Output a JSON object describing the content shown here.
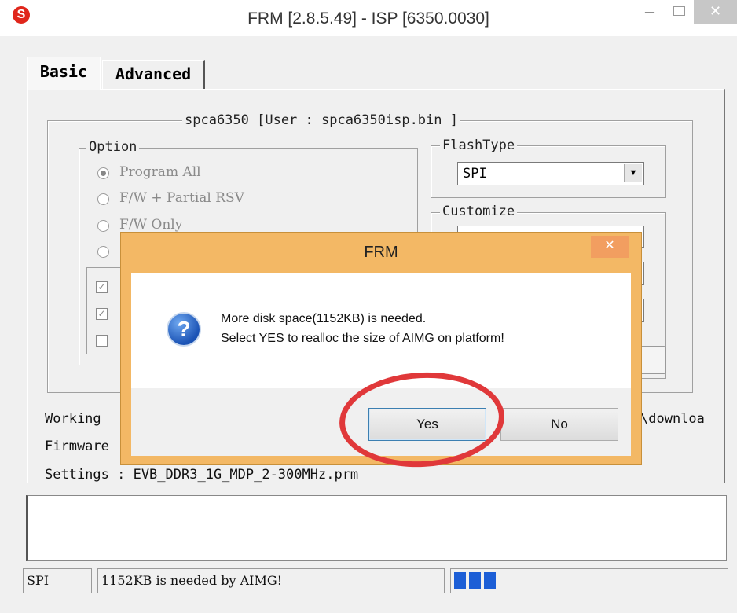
{
  "window": {
    "logo_glyph": "S",
    "title": "FRM [2.8.5.49] - ISP [6350.0030]",
    "minimize_glyph": "–",
    "close_glyph": "✕"
  },
  "tabs": [
    {
      "label": "Basic",
      "active": true
    },
    {
      "label": "Advanced",
      "active": false
    }
  ],
  "main_group": {
    "legend": "spca6350 [User : spca6350isp.bin ]"
  },
  "option_group": {
    "legend": "Option",
    "radios": [
      {
        "label": "Program All",
        "selected": true
      },
      {
        "label": "F/W + Partial RSV",
        "selected": false
      },
      {
        "label": "F/W Only",
        "selected": false
      },
      {
        "label": "",
        "selected": false
      }
    ],
    "checkboxes": [
      {
        "checked": true
      },
      {
        "checked": true
      },
      {
        "checked": false
      }
    ]
  },
  "flashtype": {
    "legend": "FlashType",
    "value": "SPI"
  },
  "customize": {
    "legend": "Customize"
  },
  "info": {
    "working_label": "Working",
    "working_tail": "\\downloa",
    "firmware_label": "Firmware",
    "settings_line": "Settings : EVB_DDR3_1G_MDP_2-300MHz.prm"
  },
  "dialog": {
    "title": "FRM",
    "close_glyph": "✕",
    "icon_glyph": "?",
    "message_line1": "More disk space(1152KB) is needed.",
    "message_line2": "Select YES to realloc the size of AIMG on platform!",
    "yes_label": "Yes",
    "no_label": "No"
  },
  "statusbar": {
    "flash": "SPI",
    "message": "1152KB is needed by AIMG!",
    "progress_blocks": 3,
    "progress_color": "#1c5ed6"
  },
  "colors": {
    "dialog_frame": "#f3b865",
    "annotation_circle": "#e0383a"
  }
}
